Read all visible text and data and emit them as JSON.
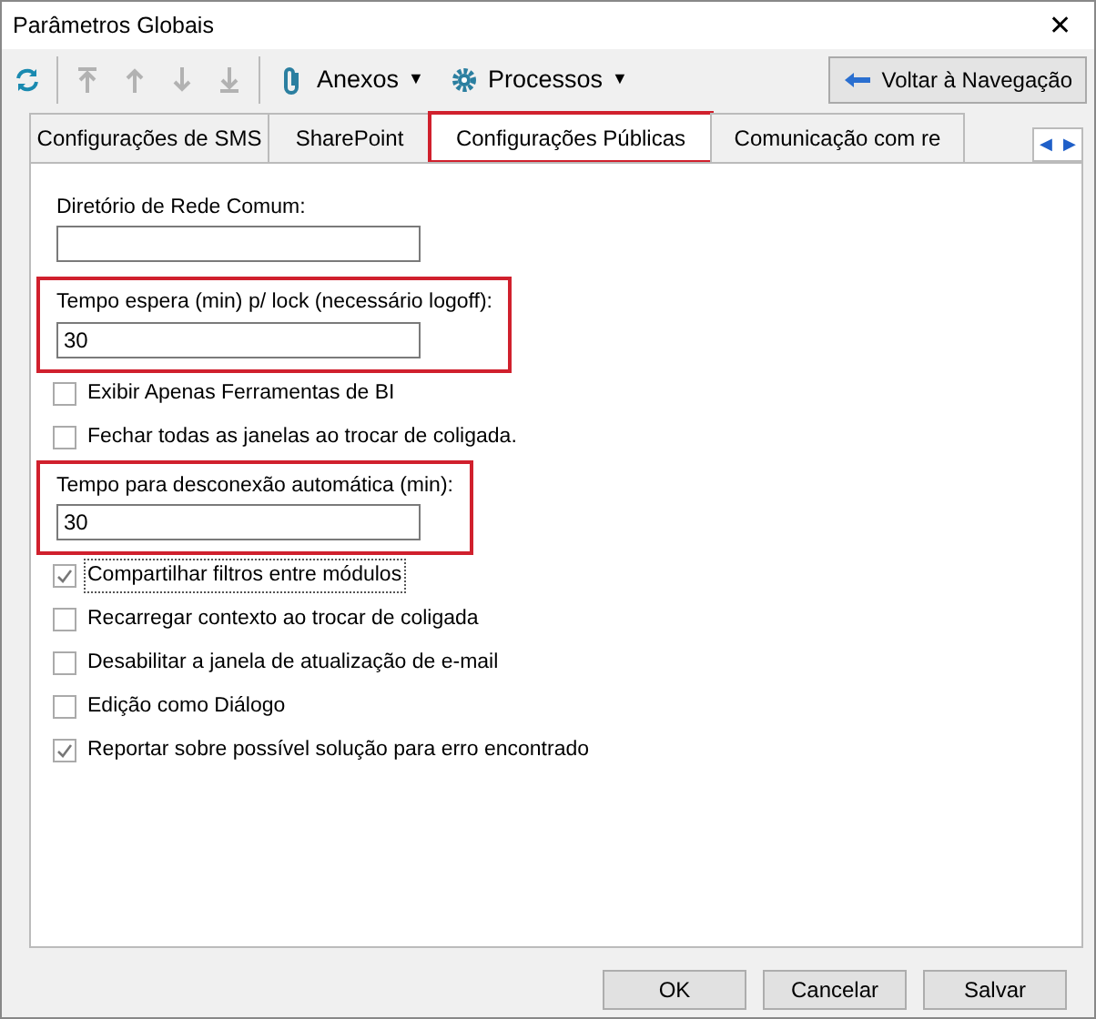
{
  "window": {
    "title": "Parâmetros Globais",
    "close": "✕"
  },
  "toolbar": {
    "buttons": [
      {
        "kind": "refresh",
        "disabled": false
      },
      {
        "kind": "top",
        "disabled": true
      },
      {
        "kind": "up",
        "disabled": true
      },
      {
        "kind": "down",
        "disabled": true
      },
      {
        "kind": "bottom",
        "disabled": true
      }
    ],
    "menus": [
      {
        "kind": "clip",
        "label": "Anexos",
        "caret": "▼"
      },
      {
        "kind": "gear",
        "label": "Processos",
        "caret": "▼"
      }
    ],
    "back_button": "Voltar à Navegação"
  },
  "tabs": [
    {
      "label": "Configurações de SMS",
      "selected": false,
      "highlighted": false
    },
    {
      "label": "SharePoint",
      "selected": false,
      "highlighted": false
    },
    {
      "label": "Configurações Públicas",
      "selected": true,
      "highlighted": true
    },
    {
      "label": "Comunicação com re",
      "selected": false,
      "highlighted": false
    }
  ],
  "tab_scroll": [
    "◀",
    "▶"
  ],
  "fields": [
    {
      "kind": "text",
      "label": "Diretório de Rede Comum:",
      "highlighted": false
    },
    {
      "kind": "text",
      "label": "Tempo espera (min) p/ lock (necessário logoff):",
      "value": "30",
      "highlighted": true
    },
    {
      "kind": "check",
      "label": "Exibir Apenas Ferramentas de BI",
      "checked": false,
      "focused": false
    },
    {
      "kind": "check",
      "label": "Fechar todas as janelas ao trocar de coligada.",
      "checked": false,
      "focused": false
    },
    {
      "kind": "text",
      "label": "Tempo para desconexão automática (min):",
      "value": "30",
      "highlighted": true
    },
    {
      "kind": "check",
      "label": "Compartilhar filtros entre módulos",
      "checked": true,
      "focused": true
    },
    {
      "kind": "check",
      "label": "Recarregar contexto ao trocar de coligada",
      "checked": false,
      "focused": false
    },
    {
      "kind": "check",
      "label": "Desabilitar a janela de atualização de e-mail",
      "checked": false,
      "focused": false
    },
    {
      "kind": "check",
      "label": "Edição como Diálogo",
      "checked": false,
      "focused": false
    },
    {
      "kind": "check",
      "label": "Reportar sobre possível solução para erro encontrado",
      "checked": true,
      "focused": false
    }
  ],
  "buttons": [
    "OK",
    "Cancelar",
    "Salvar"
  ]
}
